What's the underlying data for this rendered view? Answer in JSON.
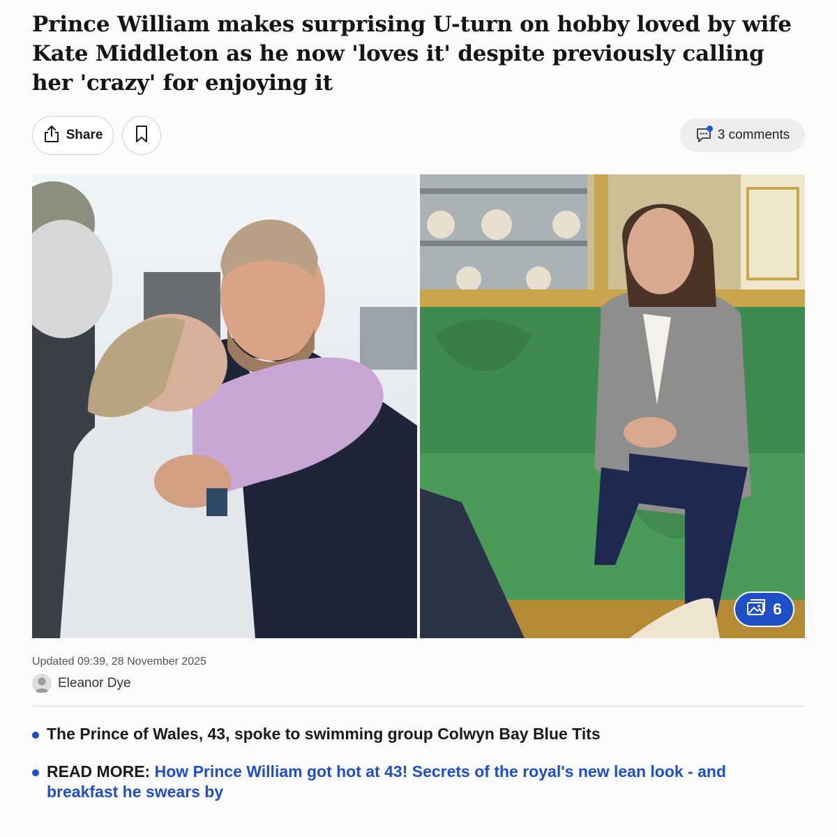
{
  "article": {
    "headline": "Prince William makes surprising U-turn on hobby loved by wife Kate Middleton as he now 'loves it' despite previously calling her 'crazy' for enjoying it",
    "updated": "Updated 09:39, 28 November 2025",
    "author": "Eleanor Dye"
  },
  "actions": {
    "share_label": "Share",
    "comments_label": "3 comments"
  },
  "gallery": {
    "count": "6"
  },
  "bullets": {
    "first": "The Prince of Wales, 43, spoke to swimming group Colwyn Bay Blue Tits",
    "readmore_prefix": "READ MORE:",
    "readmore_link": "How Prince William got hot at 43! Secrets of the royal's new lean look - and breakfast he swears by"
  },
  "colors": {
    "accent": "#1f4fc8",
    "sofa_green": "#3f8a4f"
  },
  "icons": {
    "share": "share-icon",
    "bookmark": "bookmark-icon",
    "comments": "comment-icon",
    "gallery": "gallery-icon",
    "avatar": "user-avatar-icon"
  }
}
